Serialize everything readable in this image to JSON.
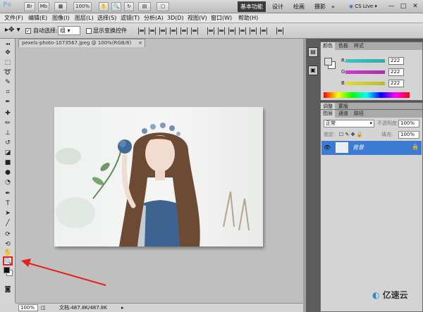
{
  "titlebar": {
    "logo": "Ps",
    "zoom": "100%",
    "workspaces": [
      "基本功能",
      "设计",
      "绘画",
      "摄影"
    ],
    "more": "»",
    "cslive": "CS Live",
    "window_buttons": [
      "—",
      "□",
      "✕"
    ]
  },
  "menu": [
    "文件(F)",
    "编辑(E)",
    "图像(I)",
    "图层(L)",
    "选择(S)",
    "滤镜(T)",
    "分析(A)",
    "3D(D)",
    "视图(V)",
    "窗口(W)",
    "帮助(H)"
  ],
  "options": {
    "auto_select_label": "自动选择:",
    "auto_select_value": "组",
    "show_transform_label": "显示变换控件"
  },
  "document": {
    "tab_title": "pexels-photo-1073567.jpeg @ 100%(RGB/8)",
    "tab_close": "×",
    "zoom": "100%",
    "doc_info": "文档:487.8K/487.8K"
  },
  "color_panel": {
    "tabs": [
      "颜色",
      "色板",
      "样式"
    ],
    "channels": [
      {
        "label": "R",
        "value": "222",
        "color": "#2fb8b8"
      },
      {
        "label": "G",
        "value": "222",
        "color": "#c52fc5"
      },
      {
        "label": "B",
        "value": "222",
        "color": "#c8c82a"
      }
    ]
  },
  "adjust_panel": {
    "tabs": [
      "调整",
      "蒙版"
    ]
  },
  "layers_panel": {
    "tabs": [
      "图层",
      "通道",
      "路径"
    ],
    "blend_mode": "正常",
    "opacity_label": "不透明度:",
    "opacity_value": "100%",
    "lock_label": "锁定:",
    "fill_label": "填充:",
    "fill_value": "100%",
    "layer_name": "背景"
  },
  "watermark": "亿速云",
  "colors": {
    "selection": "#3b7bd2",
    "highlight": "#e4211b"
  }
}
